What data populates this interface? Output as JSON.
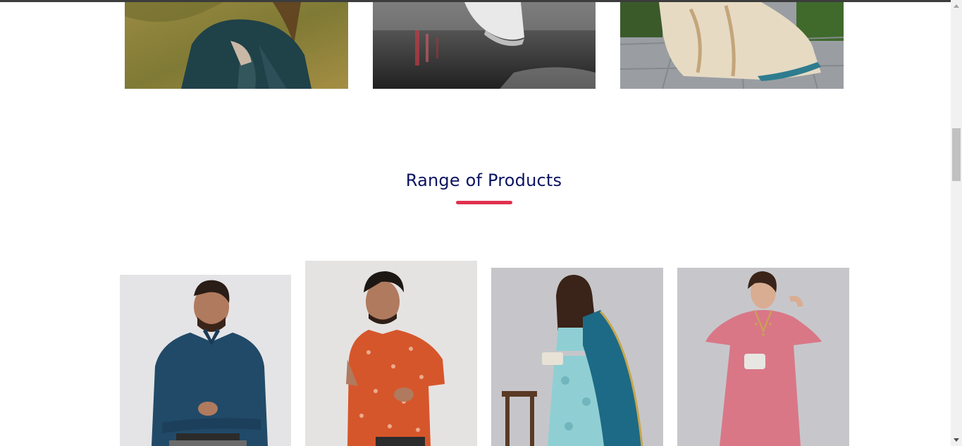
{
  "section": {
    "title": "Range of Products"
  },
  "categories": [
    {
      "image": "woman-in-denim-jacket-on-grass"
    },
    {
      "image": "white-sneaker-on-wet-street"
    },
    {
      "image": "beige-printed-saree"
    }
  ],
  "products": [
    {
      "image": "man-in-teal-formal-shirt"
    },
    {
      "image": "man-in-orange-printed-tshirt"
    },
    {
      "image": "woman-in-teal-lehenga-with-dupatta"
    },
    {
      "image": "woman-in-pink-kaftan"
    }
  ],
  "colors": {
    "title": "#0b1462",
    "accent": "#e0314f"
  }
}
